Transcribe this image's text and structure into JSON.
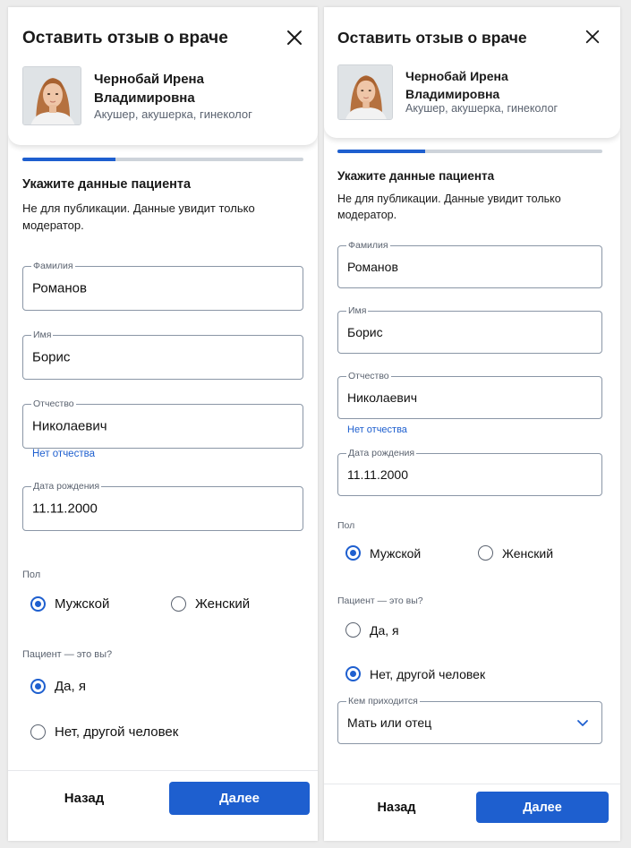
{
  "header": {
    "title": "Оставить отзыв о враче",
    "doctor_name": "Чернобай Ирена Владимировна",
    "doctor_specialty": "Акушер, акушерка, гинеколог",
    "close_icon": "close-icon",
    "avatar": "doctor-photo"
  },
  "progress": {
    "value": 0.33,
    "color": "#1e5fcf"
  },
  "section": {
    "title": "Укажите данные пациента",
    "note": "Не для публикации. Данные увидит только модератор."
  },
  "fields": {
    "last_name": {
      "label": "Фамилия",
      "value": "Романов"
    },
    "first_name": {
      "label": "Имя",
      "value": "Борис"
    },
    "patronymic": {
      "label": "Отчество",
      "value": "Николаевич"
    },
    "no_patronymic_link": "Нет отчества",
    "birth_date": {
      "label": "Дата рождения",
      "value": "11.11.2000"
    }
  },
  "gender": {
    "label": "Пол",
    "options": [
      "Мужской",
      "Женский"
    ],
    "selected": "Мужской"
  },
  "is_patient": {
    "label": "Пациент — это вы?",
    "options": [
      "Да, я",
      "Нет, другой человек"
    ],
    "selected_left": "Да, я",
    "selected_right": "Нет, другой человек"
  },
  "relation": {
    "label": "Кем приходится",
    "value": "Мать или отец",
    "icon": "chevron-down-icon"
  },
  "footer": {
    "back_label": "Назад",
    "next_label": "Далее"
  },
  "colors": {
    "accent": "#1e5fcf",
    "muted_text": "#5b6370",
    "border": "#8a96a6"
  }
}
